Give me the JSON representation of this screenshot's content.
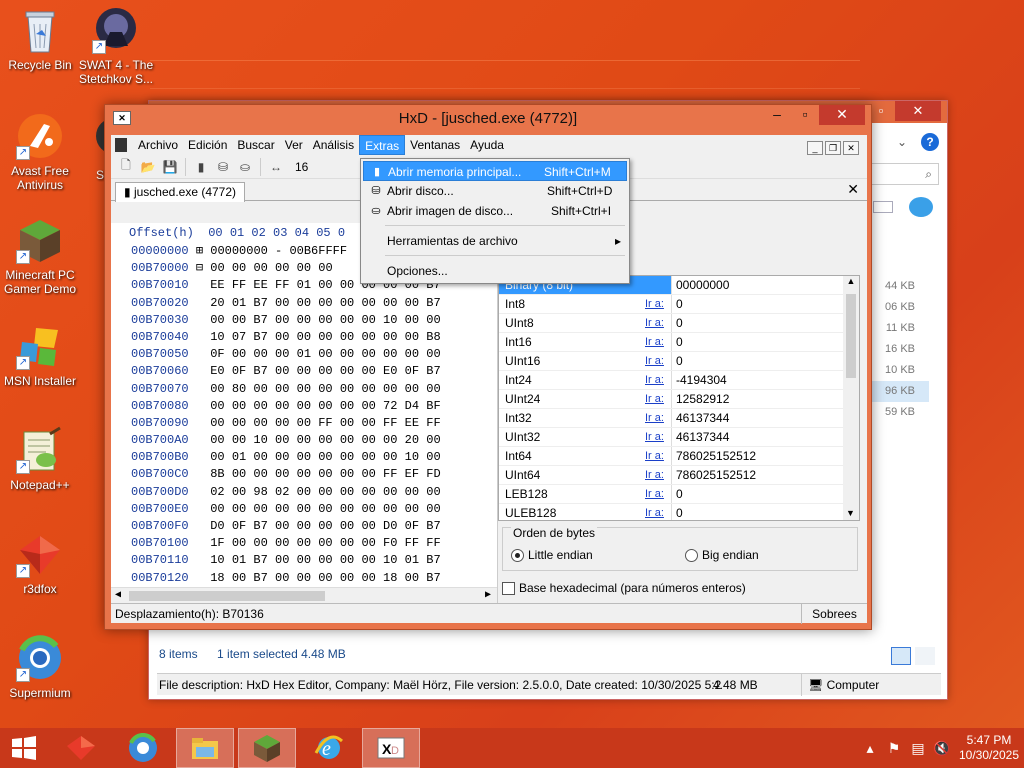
{
  "desktop": {
    "icons": [
      {
        "label": "Recycle Bin"
      },
      {
        "label": "SWAT 4 - The Stetchkov S..."
      },
      {
        "label": "Avast Free Antivirus"
      },
      {
        "label": "Minecraft PC Gamer Demo"
      },
      {
        "label": "MSN Installer"
      },
      {
        "label": "Notepad++"
      },
      {
        "label": "r3dfox"
      },
      {
        "label": "Supermium"
      },
      {
        "label": "Sy"
      }
    ]
  },
  "explorer": {
    "sizes": [
      "44 KB",
      "06 KB",
      "11 KB",
      "16 KB",
      "10 KB",
      "96 KB",
      "59 KB"
    ],
    "items_count": "8 items",
    "selected_info": "1 item selected  4.48 MB",
    "file_description": "File description: HxD Hex Editor, Company: Maël Hörz, File version: 2.5.0.0, Date created: 10/30/2025 5:2",
    "desc_size": "4.48 MB",
    "computer": "Computer"
  },
  "hxd": {
    "title": "HxD - [jusched.exe (4772)]",
    "menu": [
      "Archivo",
      "Edición",
      "Buscar",
      "Ver",
      "Análisis",
      "Extras",
      "Ventanas",
      "Ayuda"
    ],
    "toolbar_columns": "16",
    "tab_label": "jusched.exe (4772)",
    "hex_header": "Offset(h)  00 01 02 03 04 05 0",
    "hex_rows": [
      {
        "off": "00000000",
        "bytes": "⊞ 00000000 - 00B6FFFF"
      },
      {
        "off": "00B70000",
        "bytes": "⊟ 00 00 00 00 00 00"
      },
      {
        "off": "00B70010",
        "bytes": "  EE FF EE FF 01 00 00 00 00 00 B7"
      },
      {
        "off": "00B70020",
        "bytes": "  20 01 B7 00 00 00 00 00 00 00 B7"
      },
      {
        "off": "00B70030",
        "bytes": "  00 00 B7 00 00 00 00 00 10 00 00"
      },
      {
        "off": "00B70040",
        "bytes": "  10 07 B7 00 00 00 00 00 00 00 B8"
      },
      {
        "off": "00B70050",
        "bytes": "  0F 00 00 00 01 00 00 00 00 00 00"
      },
      {
        "off": "00B70060",
        "bytes": "  E0 0F B7 00 00 00 00 00 E0 0F B7"
      },
      {
        "off": "00B70070",
        "bytes": "  00 80 00 00 00 00 00 00 00 00 00"
      },
      {
        "off": "00B70080",
        "bytes": "  00 00 00 00 00 00 00 00 72 D4 BF"
      },
      {
        "off": "00B70090",
        "bytes": "  00 00 00 00 00 FF 00 00 FF EE FF"
      },
      {
        "off": "00B700A0",
        "bytes": "  00 00 10 00 00 00 00 00 00 20 00"
      },
      {
        "off": "00B700B0",
        "bytes": "  00 01 00 00 00 00 00 00 00 10 00"
      },
      {
        "off": "00B700C0",
        "bytes": "  8B 00 00 00 00 00 00 00 FF EF FD"
      },
      {
        "off": "00B700D0",
        "bytes": "  02 00 98 02 00 00 00 00 00 00 00"
      },
      {
        "off": "00B700E0",
        "bytes": "  00 00 00 00 00 00 00 00 00 00 00"
      },
      {
        "off": "00B700F0",
        "bytes": "  D0 0F B7 00 00 00 00 00 D0 0F B7"
      },
      {
        "off": "00B70100",
        "bytes": "  1F 00 00 00 00 00 00 00 F0 FF FF"
      },
      {
        "off": "00B70110",
        "bytes": "  10 01 B7 00 00 00 00 00 10 01 B7"
      },
      {
        "off": "00B70120",
        "bytes": "  18 00 B7 00 00 00 00 00 18 00 B7"
      },
      {
        "off": "00B70130",
        "bytes": "  00 00 00 00 00 00 00 00 C0 02 B7"
      }
    ],
    "inspector": [
      {
        "name": "Binary (8 bit)",
        "link": "",
        "value": "00000000"
      },
      {
        "name": "Int8",
        "link": "Ir a:",
        "value": "0"
      },
      {
        "name": "UInt8",
        "link": "Ir a:",
        "value": "0"
      },
      {
        "name": "Int16",
        "link": "Ir a:",
        "value": "0"
      },
      {
        "name": "UInt16",
        "link": "Ir a:",
        "value": "0"
      },
      {
        "name": "Int24",
        "link": "Ir a:",
        "value": "-4194304"
      },
      {
        "name": "UInt24",
        "link": "Ir a:",
        "value": "12582912"
      },
      {
        "name": "Int32",
        "link": "Ir a:",
        "value": "46137344"
      },
      {
        "name": "UInt32",
        "link": "Ir a:",
        "value": "46137344"
      },
      {
        "name": "Int64",
        "link": "Ir a:",
        "value": "786025152512"
      },
      {
        "name": "UInt64",
        "link": "Ir a:",
        "value": "786025152512"
      },
      {
        "name": "LEB128",
        "link": "Ir a:",
        "value": "0"
      },
      {
        "name": "ULEB128",
        "link": "Ir a:",
        "value": "0"
      }
    ],
    "byte_order_label": "Orden de bytes",
    "little_endian": "Little endian",
    "big_endian": "Big endian",
    "hex_base_label": "Base hexadecimal (para números enteros)",
    "status_offset": "Desplazamiento(h): B70136",
    "status_mode": "Sobrees",
    "extras_menu": [
      {
        "label": "Abrir memoria principal...",
        "shortcut": "Shift+Ctrl+M"
      },
      {
        "label": "Abrir disco...",
        "shortcut": "Shift+Ctrl+D"
      },
      {
        "label": "Abrir imagen de disco...",
        "shortcut": "Shift+Ctrl+I"
      },
      {
        "label": "Herramientas de archivo",
        "shortcut": "▸"
      },
      {
        "label": "Opciones...",
        "shortcut": ""
      }
    ]
  },
  "taskbar": {
    "time": "5:47 PM",
    "date": "10/30/2025"
  }
}
